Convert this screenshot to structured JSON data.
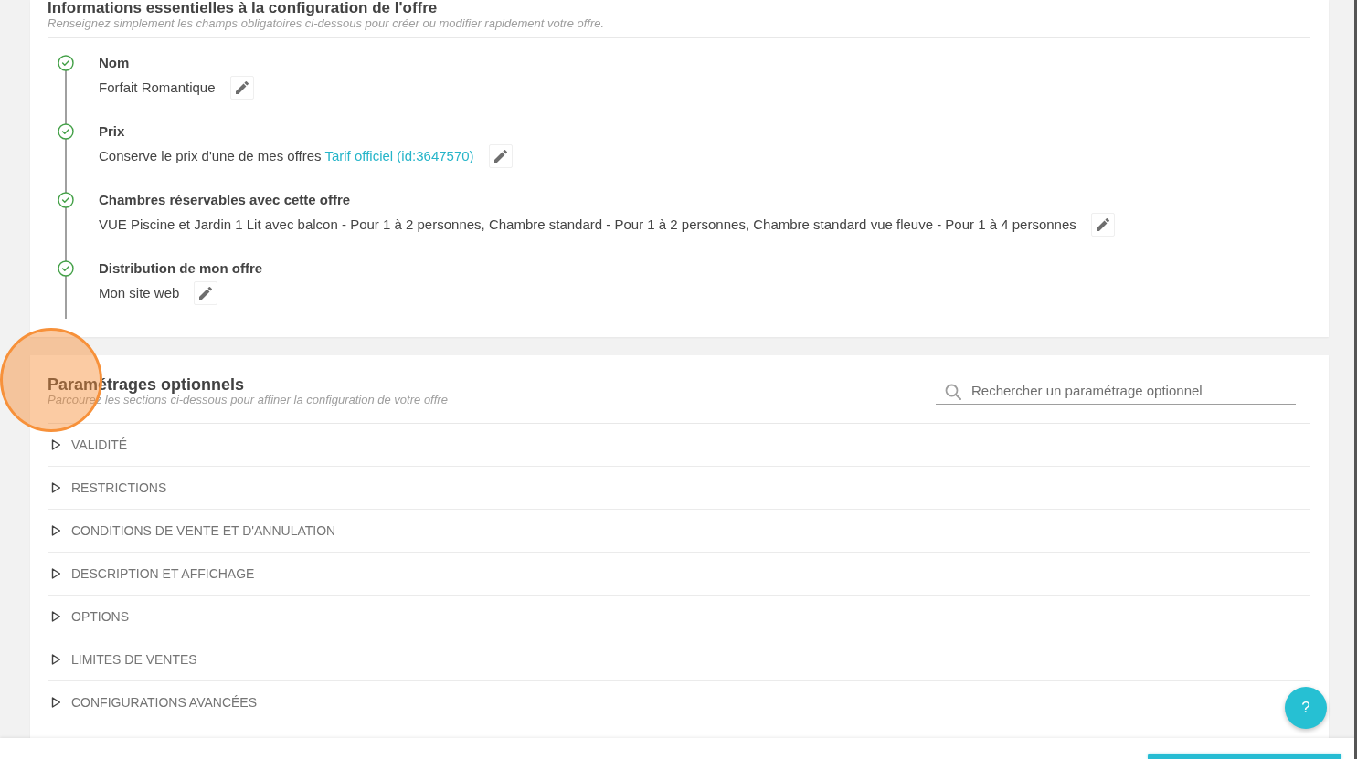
{
  "essentials": {
    "title": "Informations essentielles à la configuration de l'offre",
    "subtitle": "Renseignez simplement les champs obligatoires ci-dessous pour créer ou modifier rapidement votre offre.",
    "steps": [
      {
        "label": "Nom",
        "value": "Forfait Romantique",
        "completed": true
      },
      {
        "label": "Prix",
        "value": "Conserve le prix d'une de mes offres",
        "link": "Tarif officiel (id:3647570)",
        "completed": true
      },
      {
        "label": "Chambres réservables avec cette offre",
        "value": "VUE Piscine et Jardin 1 Lit avec balcon - Pour 1 à 2 personnes, Chambre standard - Pour 1 à 2 personnes, Chambre standard vue fleuve - Pour 1 à 4 personnes",
        "completed": true
      },
      {
        "label": "Distribution de mon offre",
        "value": "Mon site web",
        "completed": true
      }
    ]
  },
  "optional": {
    "title": "Paramétrages optionnels",
    "subtitle": "Parcourez les sections ci-dessous pour affiner la configuration de votre offre",
    "search": {
      "placeholder": "Rechercher un paramétrage optionnel"
    },
    "sections": [
      {
        "label": "VALIDITÉ",
        "expanded": false
      },
      {
        "label": "RESTRICTIONS",
        "expanded": false
      },
      {
        "label": "CONDITIONS DE VENTE ET D'ANNULATION",
        "expanded": false
      },
      {
        "label": "DESCRIPTION ET AFFICHAGE",
        "expanded": false
      },
      {
        "label": "OPTIONS",
        "expanded": false
      },
      {
        "label": "LIMITES DE VENTES",
        "expanded": false
      },
      {
        "label": "CONFIGURATIONS AVANCÉES",
        "expanded": false
      }
    ]
  },
  "help_button": {
    "label": "?"
  }
}
